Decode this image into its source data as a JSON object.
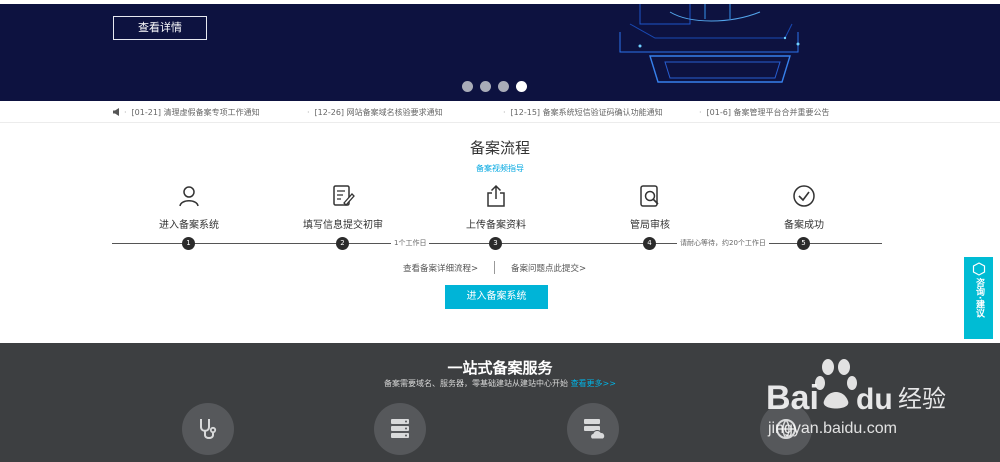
{
  "banner": {
    "button_label": "查看详情",
    "carousel_dots": 4,
    "active_dot": 4
  },
  "notices": [
    {
      "text": "[01-21]  清理虚假备案专项工作通知"
    },
    {
      "text": "[12-26]  网站备案域名核验要求通知"
    },
    {
      "text": "[12-15]  备案系统短信验证码确认功能通知"
    },
    {
      "text": "[01-6]  备案管理平台合并重要公告"
    }
  ],
  "process": {
    "title": "备案流程",
    "video_guide": "备案视频指导",
    "steps": [
      {
        "label": "进入备案系统",
        "num": "1",
        "icon": "user-icon"
      },
      {
        "label": "填写信息提交初审",
        "num": "2",
        "icon": "form-edit-icon"
      },
      {
        "label": "上传备案资料",
        "num": "3",
        "icon": "upload-icon"
      },
      {
        "label": "管局审核",
        "num": "4",
        "icon": "review-search-icon"
      },
      {
        "label": "备案成功",
        "num": "5",
        "icon": "check-circle-icon"
      }
    ],
    "timeline_notes": [
      "1个工作日",
      "请耐心等待，约20个工作日"
    ],
    "link_detail": "查看备案详细流程>",
    "link_question": "备案问题点此提交>",
    "enter_button": "进入备案系统"
  },
  "side_tab": {
    "text": "咨询·建议",
    "icon": "chat-hexagon-icon"
  },
  "services": {
    "title": "一站式备案服务",
    "subtitle": "备案需要域名、服务器，零基础建站从建站中心开始",
    "more_link": "查看更多>>",
    "icons": [
      "stethoscope-icon",
      "server-icon",
      "cloud-server-icon",
      "globe-icon"
    ]
  },
  "watermark": {
    "text": "jingyan.baidu.com",
    "logo": "Bai du 经验"
  },
  "colors": {
    "banner_bg": "#0d1240",
    "accent": "#00b4d7",
    "link": "#00a7e1",
    "services_bg": "#3d3f41"
  }
}
